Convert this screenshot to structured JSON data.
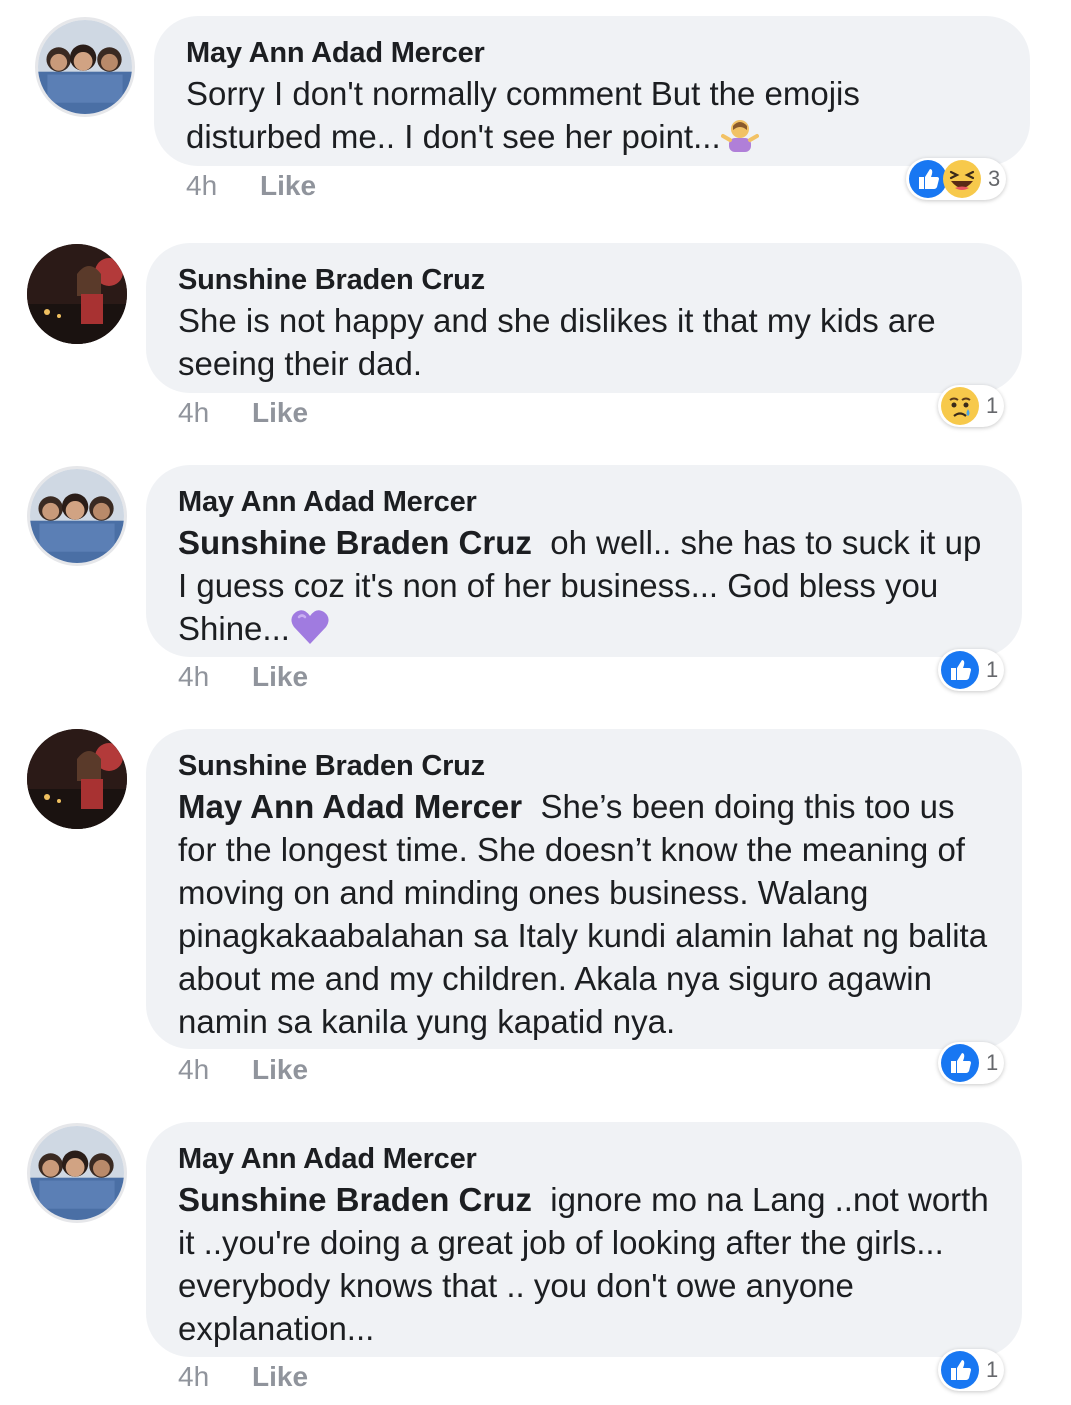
{
  "comments": [
    {
      "author": "May Ann Adad Mercer",
      "mention": "",
      "text": "Sorry I don't normally comment But the emojis disturbed me.. I don't see her point...",
      "emoji_suffix": "person-shrugging-emoji",
      "time": "4h",
      "like_label": "Like",
      "reactions": [
        "like",
        "haha"
      ],
      "reaction_count": "3"
    },
    {
      "author": "Sunshine Braden Cruz",
      "mention": "",
      "text": "She is not happy and she dislikes it that my kids are seeing their dad.",
      "emoji_suffix": "",
      "time": "4h",
      "like_label": "Like",
      "reactions": [
        "sad"
      ],
      "reaction_count": "1"
    },
    {
      "author": "May Ann Adad Mercer",
      "mention": "Sunshine Braden Cruz",
      "text": "oh well.. she has to suck it up I guess coz it's non of her business... God bless you Shine...",
      "emoji_suffix": "purple-heart-emoji",
      "time": "4h",
      "like_label": "Like",
      "reactions": [
        "like"
      ],
      "reaction_count": "1"
    },
    {
      "author": "Sunshine Braden Cruz",
      "mention": "May Ann Adad Mercer",
      "text": "She’s been doing this too us for the longest time. She doesn’t know the meaning of moving on and minding ones business. Walang pinagkakaabalahan sa Italy kundi alamin lahat ng balita about me and my children. Akala nya siguro agawin namin sa kanila yung kapatid nya.",
      "emoji_suffix": "",
      "time": "4h",
      "like_label": "Like",
      "reactions": [
        "like"
      ],
      "reaction_count": "1"
    },
    {
      "author": "May Ann Adad Mercer",
      "mention": "Sunshine Braden Cruz",
      "text": "ignore mo na Lang ..not worth it ..you're doing a great job of looking after the girls... everybody knows that .. you don't owe anyone explanation...",
      "emoji_suffix": "",
      "time": "4h",
      "like_label": "Like",
      "reactions": [
        "like"
      ],
      "reaction_count": "1"
    }
  ],
  "colors": {
    "bubble": "#f0f2f5",
    "meta_text": "#90949c",
    "like_blue": "#1877f2",
    "haha_yellow": "#f7c94b",
    "heart_purple": "#a07be0"
  }
}
